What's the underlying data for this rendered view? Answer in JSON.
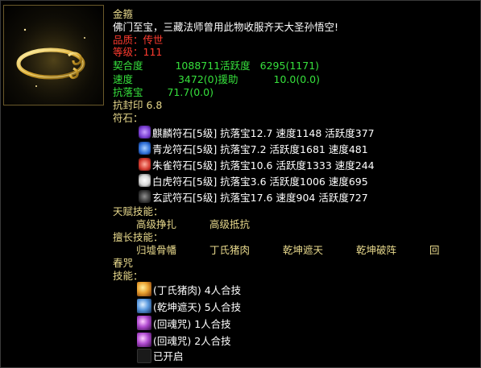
{
  "item": {
    "name": "金箍",
    "description": "佛门至宝，三藏法师曾用此物收服齐天大圣孙悟空!",
    "quality_label": "品质：",
    "quality_value": "传世",
    "level_label": "等级：",
    "level_value": "111"
  },
  "stats": {
    "fit_label": "契合度",
    "fit_value": "1088711",
    "activity_label": "活跃度",
    "activity_value": "6295(1171)",
    "speed_label": "速度",
    "speed_value": "3472(0)",
    "assist_label": "援助",
    "assist_value": "10.0(0.0)",
    "resist_label": "抗落宝",
    "resist_value": "71.7(0.0)",
    "seal_label": "抗封印",
    "seal_value": "6.8"
  },
  "runes_header": "符石：",
  "runes": [
    {
      "icon": "qilin-rune-icon",
      "text": "麒麟符石[5级] 抗落宝12.7 速度1148 活跃度377",
      "color": "#7a3fd4"
    },
    {
      "icon": "dragon-rune-icon",
      "text": "青龙符石[5级] 抗落宝7.2 活跃度1681 速度481",
      "color": "#2f6fd6"
    },
    {
      "icon": "phoenix-rune-icon",
      "text": "朱雀符石[5级] 抗落宝10.6 活跃度1333 速度244",
      "color": "#d43a2f"
    },
    {
      "icon": "tiger-rune-icon",
      "text": "白虎符石[5级] 抗落宝3.6 活跃度1006 速度695",
      "color": "#d8d8d8"
    },
    {
      "icon": "tortoise-rune-icon",
      "text": "玄武符石[5级] 抗落宝17.6 速度904 活跃度727",
      "color": "#3a3a3a"
    }
  ],
  "talent_header": "天赋技能：",
  "talents": [
    "高级挣扎",
    "高级抵抗"
  ],
  "specialty_header": "擅长技能：",
  "specialties": [
    "归墟骨幡",
    "丁氏猪肉",
    "乾坤遮天",
    "乾坤破阵",
    "回"
  ],
  "specialty_wrap": "春咒",
  "skills_header": "技能：",
  "skills": [
    {
      "icon": "pork-skill-icon",
      "text": "(丁氏猪肉) 4人合技",
      "color": "#e8a030"
    },
    {
      "icon": "qiankun-skill-icon",
      "text": "(乾坤遮天) 5人合技",
      "color": "#5a9ae0"
    },
    {
      "icon": "soul-skill-icon",
      "text": "(回魂咒) 1人合技",
      "color": "#b04ad0"
    },
    {
      "icon": "soul-skill-icon",
      "text": "(回魂咒) 2人合技",
      "color": "#b04ad0"
    }
  ],
  "unlocked_text": "已开启"
}
